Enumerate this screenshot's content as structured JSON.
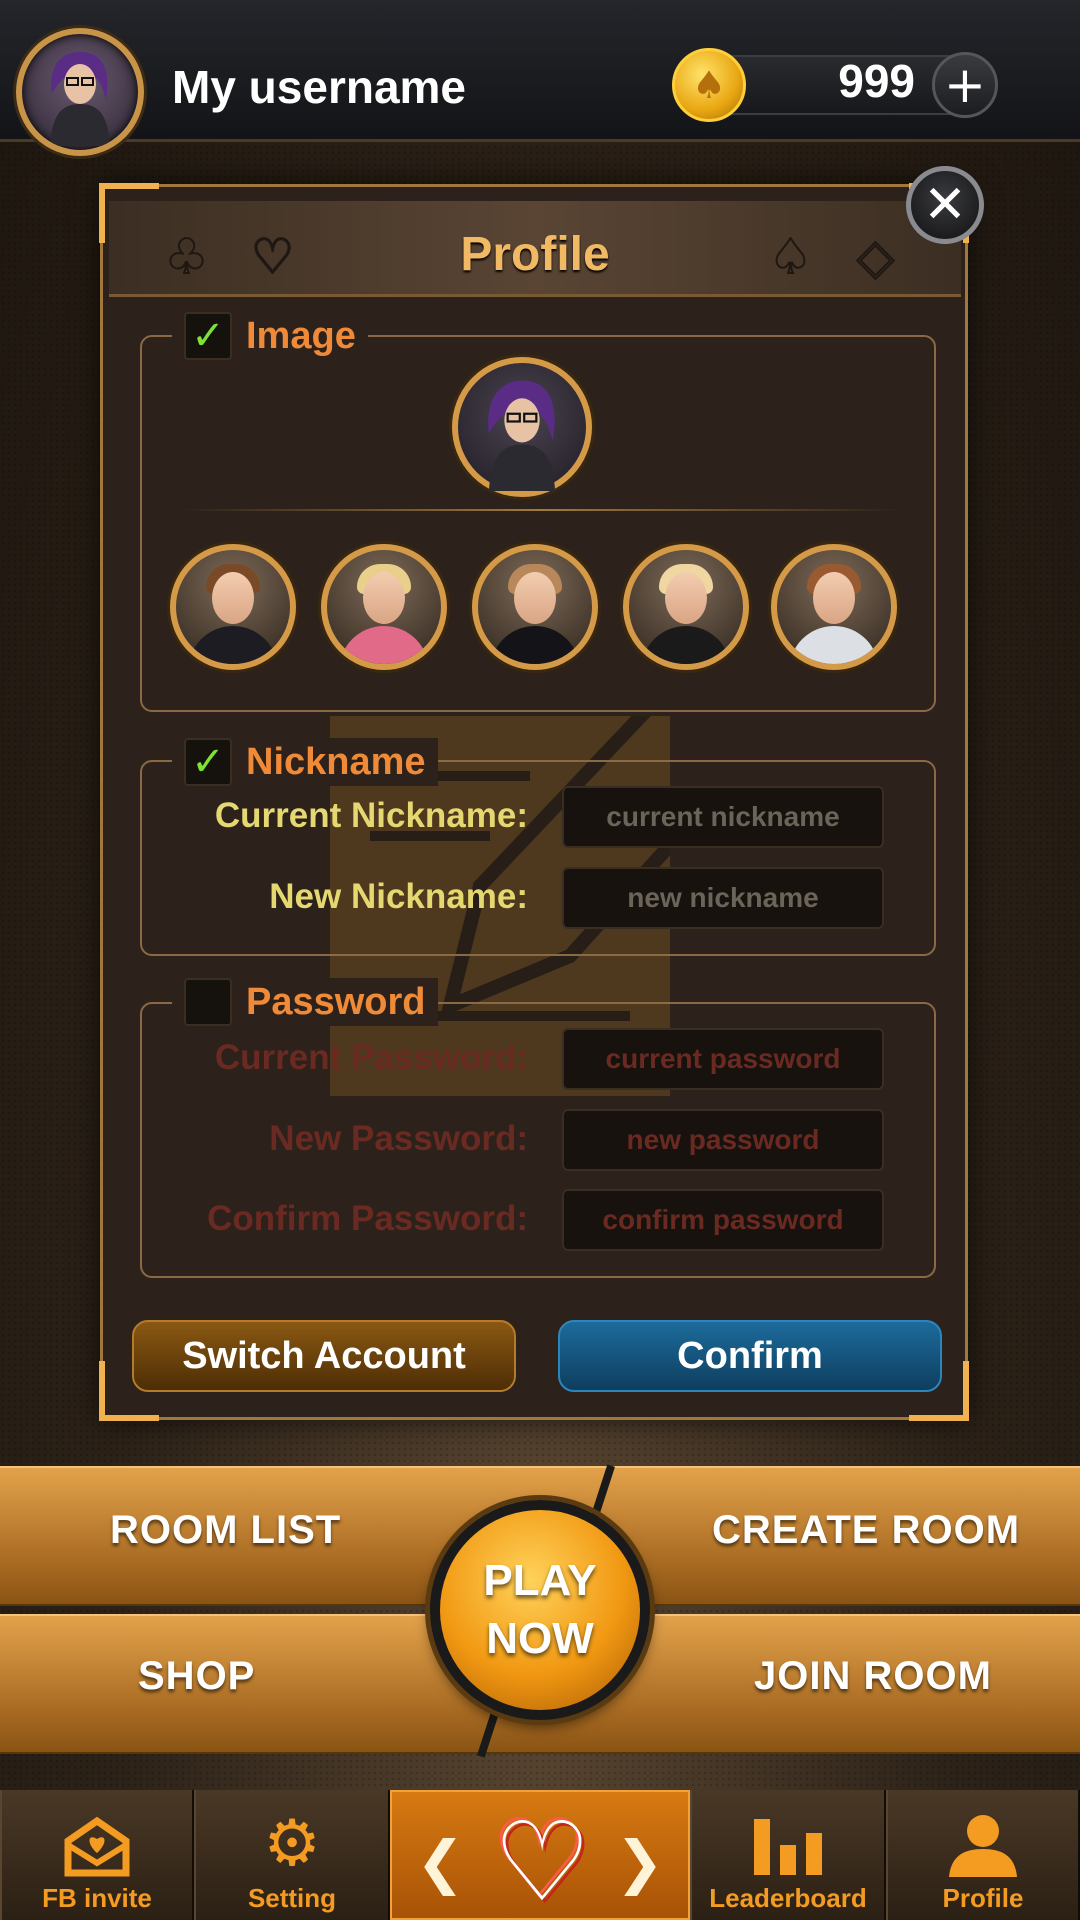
{
  "header": {
    "username": "My username",
    "coins": "999",
    "add_coins_symbol": "+",
    "coin_icon": "spade-coin-icon"
  },
  "dialog": {
    "title": "Profile",
    "close_symbol": "✕",
    "suits": [
      "♣",
      "♡",
      "♠",
      "◇"
    ],
    "image_section": {
      "label": "Image",
      "checked": true,
      "avatar_options": [
        "male-red-tie",
        "female-blonde-pink",
        "male-bowtie",
        "female-blonde-black",
        "female-brown-white"
      ]
    },
    "nickname_section": {
      "label": "Nickname",
      "checked": true,
      "current_label": "Current Nickname:",
      "current_placeholder": "current nickname",
      "new_label": "New Nickname:",
      "new_placeholder": "new nickname"
    },
    "password_section": {
      "label": "Password",
      "checked": false,
      "current_label": "Current Password:",
      "current_placeholder": "current password",
      "new_label": "New Password:",
      "new_placeholder": "new password",
      "confirm_label": "Confirm Password:",
      "confirm_placeholder": "confirm password"
    },
    "switch_account_label": "Switch Account",
    "confirm_label": "Confirm",
    "check_mark": "✓"
  },
  "menu": {
    "room_list": "ROOM LIST",
    "create_room": "CREATE ROOM",
    "shop": "SHOP",
    "join_room": "JOIN ROOM",
    "play_line1": "PLAY",
    "play_line2": "NOW"
  },
  "nav": {
    "fb_invite": "FB invite",
    "setting": "Setting",
    "leaderboard": "Leaderboard",
    "profile": "Profile",
    "prev_arrow": "❮",
    "next_arrow": "❯"
  },
  "colors": {
    "accent_orange": "#ef8a38",
    "gold": "#d49a48",
    "confirm_blue": "#1c6b9c",
    "nav_orange": "#f49b22"
  }
}
